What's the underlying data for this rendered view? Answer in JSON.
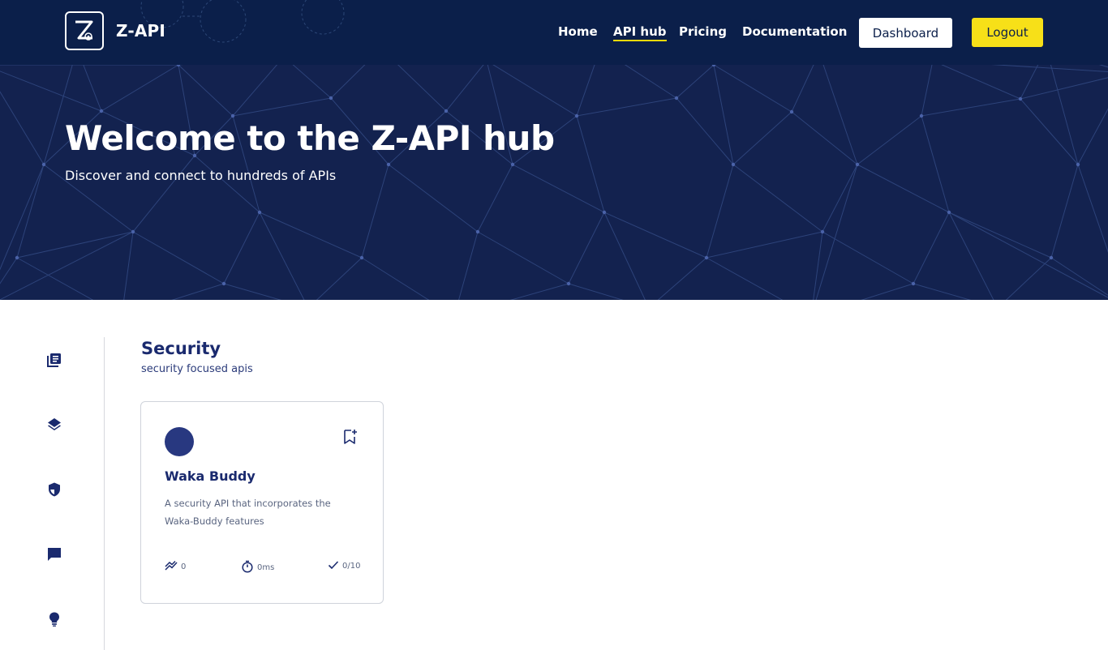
{
  "header": {
    "logo_text": "Z-API",
    "nav": [
      "Home",
      "API hub",
      "Pricing",
      "Documentation"
    ],
    "active_nav": "API hub",
    "dashboard_label": "Dashboard",
    "logout_label": "Logout"
  },
  "hero": {
    "title": "Welcome to the Z-API hub",
    "subtitle": "Discover and connect to hundreds of APIs"
  },
  "sidebar": {
    "icons": [
      "library-icon",
      "layers-icon",
      "shield-icon",
      "chat-icon",
      "lightbulb-icon"
    ]
  },
  "category": {
    "title": "Security",
    "description": "security focused apis"
  },
  "cards": [
    {
      "name": "Waka Buddy",
      "description": "A security API that incorporates the Waka-Buddy features",
      "popularity": "0",
      "latency": "0ms",
      "service_level": "0/10"
    }
  ],
  "colors": {
    "navy": "#0b1f4a",
    "hero_bg": "#13224f",
    "accent_yellow": "#f7e018",
    "title_blue": "#1a2a6e",
    "avatar": "#283880"
  }
}
